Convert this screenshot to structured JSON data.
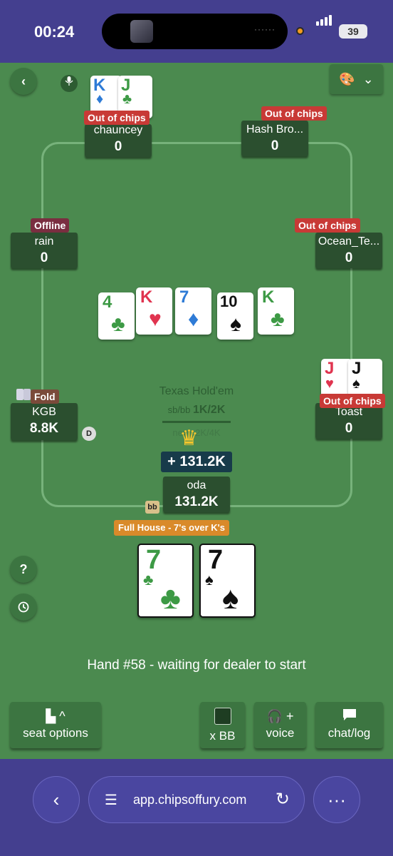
{
  "status_bar": {
    "time": "00:24",
    "battery": "39"
  },
  "table": {
    "game_type": "Texas Hold'em",
    "blinds_label": "sb/bb",
    "blinds": "1K/2K",
    "next_label": "next: 2K/4K"
  },
  "players": {
    "chauncey": {
      "name": "chauncey",
      "chips": "0",
      "badge": "Out of chips"
    },
    "hash": {
      "name": "Hash Bro...",
      "chips": "0",
      "badge": "Out of chips"
    },
    "rain": {
      "name": "rain",
      "chips": "0",
      "badge": "Offline"
    },
    "ocean": {
      "name": "Ocean_Te...",
      "chips": "0",
      "badge": "Out of chips"
    },
    "kgb": {
      "name": "KGB",
      "chips": "8.8K",
      "badge": "Fold"
    },
    "toast": {
      "name": "Toast",
      "chips": "0",
      "badge": "Out of chips"
    },
    "oda": {
      "name": "oda",
      "chips": "131.2K"
    }
  },
  "markers": {
    "dealer": "D",
    "big_blind": "bb"
  },
  "cards": {
    "chauncey": [
      {
        "rank": "K",
        "suit": "♦"
      },
      {
        "rank": "J",
        "suit": "♣"
      }
    ],
    "toast": [
      {
        "rank": "J",
        "suit": "♥"
      },
      {
        "rank": "J",
        "suit": "♠"
      }
    ],
    "community": [
      {
        "rank": "4",
        "suit": "♣"
      },
      {
        "rank": "K",
        "suit": "♥"
      },
      {
        "rank": "7",
        "suit": "♦"
      },
      {
        "rank": "10",
        "suit": "♠"
      },
      {
        "rank": "K",
        "suit": "♣"
      }
    ],
    "hero": [
      {
        "rank": "7",
        "suit": "♣"
      },
      {
        "rank": "7",
        "suit": "♠"
      }
    ]
  },
  "result": {
    "win_amount": "+ 131.2K",
    "hand_name": "Full House - 7's over K's"
  },
  "status_message": "Hand #58 - waiting for dealer to start",
  "controls": {
    "seat_options": "seat options",
    "x_bb": "x BB",
    "voice": "voice",
    "chat_log": "chat/log",
    "help": "?",
    "palette_caret": "⌄"
  },
  "browser": {
    "url": "app.chipsoffury.com"
  },
  "colors": {
    "felt": "#4b8a4f",
    "seat": "#2b4f2f",
    "badge_red": "#c83a36",
    "browser": "#443f8f"
  },
  "icons": [
    "back-icon",
    "mic-icon",
    "palette-icon",
    "help-icon",
    "history-icon",
    "seat-icon",
    "headset-icon",
    "chat-icon",
    "reload-icon",
    "more-icon"
  ]
}
